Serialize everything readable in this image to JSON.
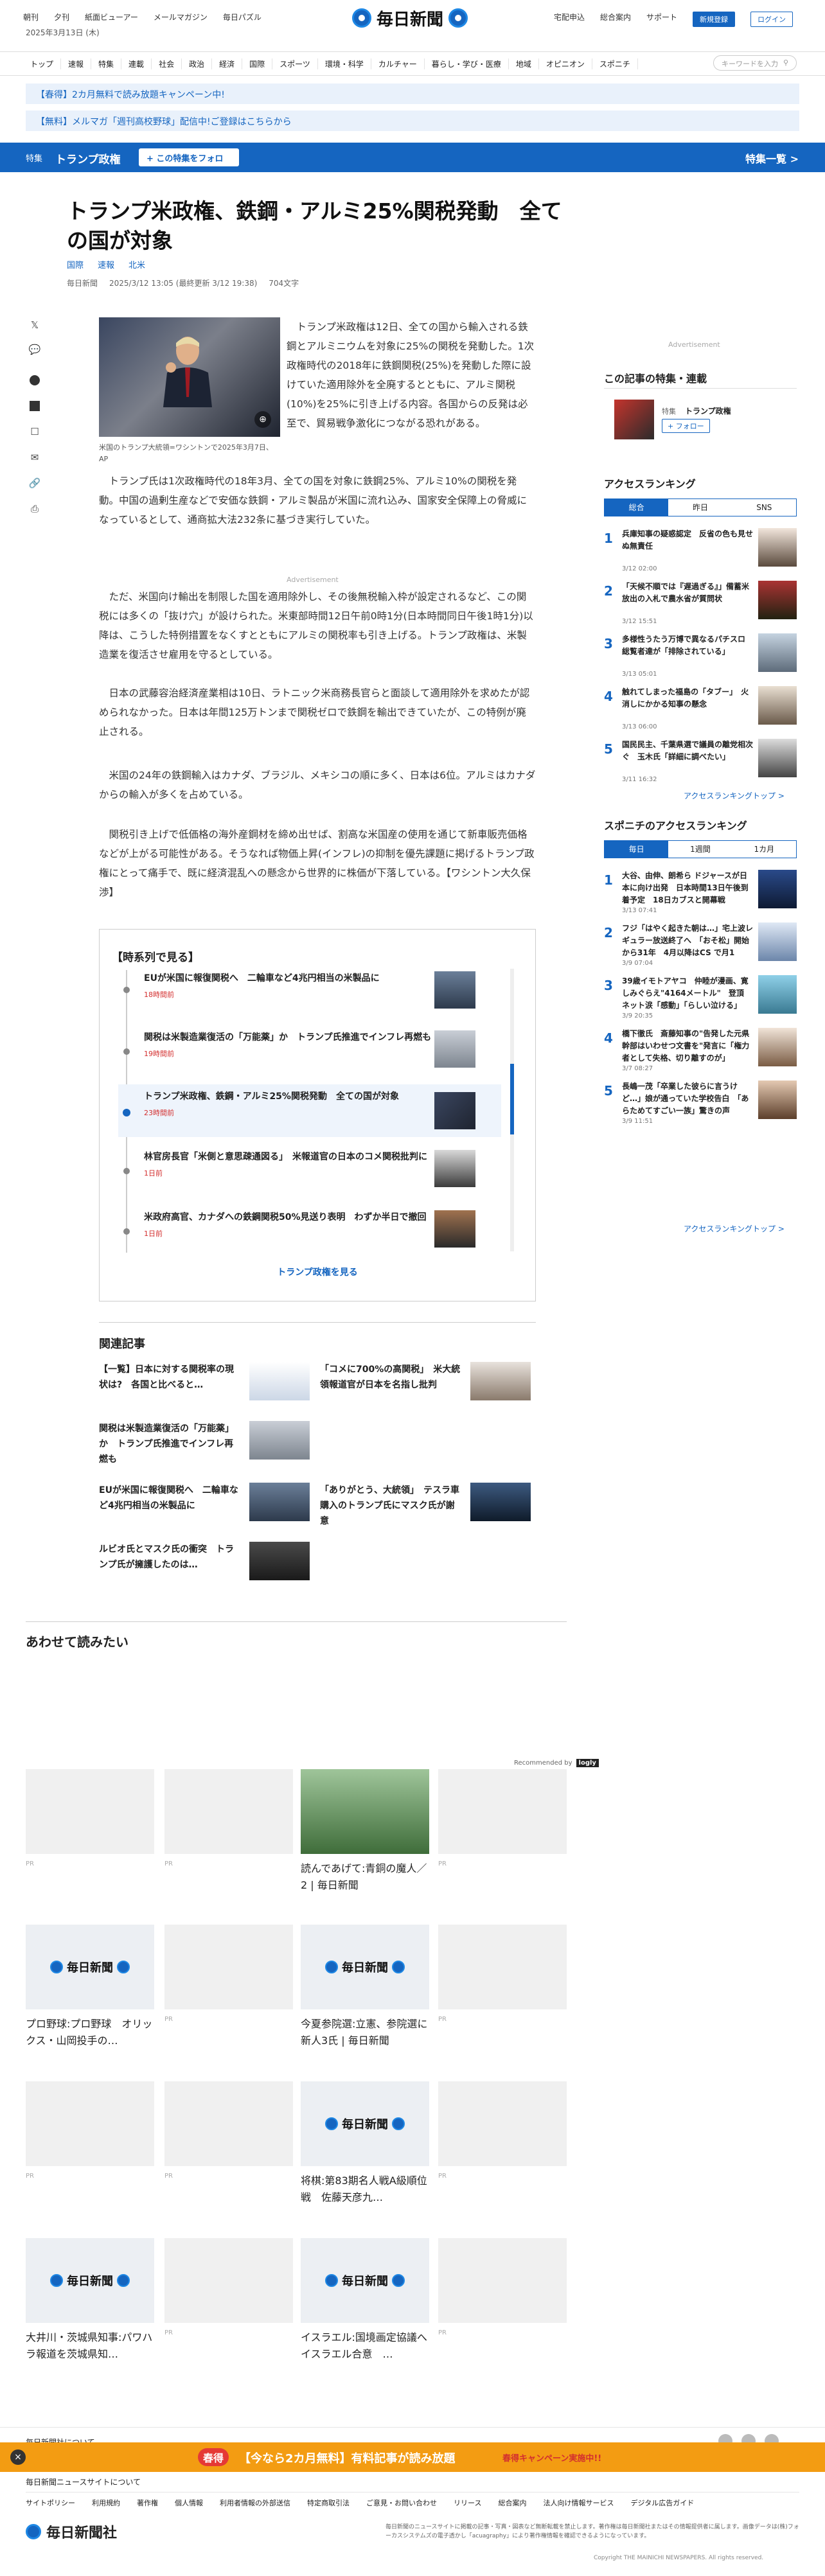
{
  "header": {
    "top_nav": [
      "朝刊",
      "夕刊",
      "紙面ビューアー",
      "メールマガジン",
      "毎日パズル"
    ],
    "date": "2025年3月13日 (木)",
    "logo": "毎日新聞",
    "right_nav": [
      "宅配申込",
      "総合案内",
      "サポート"
    ],
    "register": "新規登録",
    "login": "ログイン"
  },
  "categories": [
    "トップ",
    "速報",
    "特集",
    "連載",
    "社会",
    "政治",
    "経済",
    "国際",
    "スポーツ",
    "環境・科学",
    "カルチャー",
    "暮らし・学び・医療",
    "地域",
    "オピニオン",
    "スポニチ"
  ],
  "search": {
    "placeholder": "キーワードを入力"
  },
  "promos": [
    "【春得】2カ月無料で読み放題キャンペーン中!",
    "【無料】メルマガ「週刊高校野球」配信中!ご登録はこちらから"
  ],
  "tokushu": {
    "label": "特集",
    "name": "トランプ政権",
    "follow": "+ この特集をフォロー",
    "list": "特集一覧 >"
  },
  "article": {
    "title": "トランプ米政権、鉄鋼・アルミ25%関税発動　全ての国が対象",
    "tags": [
      "国際",
      "速報",
      "北米"
    ],
    "source": "毎日新聞",
    "date": "2025/3/12 13:05 (最終更新 3/12 19:38)",
    "chars": "704文字",
    "caption": "米国のトランプ大統領=ワシントンで2025年3月7日、AP",
    "p1": "トランプ米政権は12日、全ての国から輸入される鉄鋼とアルミニウムを対象に25%の関税を発動した。1次政権時代の2018年に鉄鋼関税(25%)を発動した際に設けていた適用除外を全廃するとともに、アルミ関税(10%)を25%に引き上げる内容。各国からの反発は必至で、貿易戦争激化につながる恐れがある。",
    "p2": "トランプ氏は1次政権時代の18年3月、全ての国を対象に鉄鋼25%、アルミ10%の関税を発動。中国の過剰生産などで安価な鉄鋼・アルミ製品が米国に流れ込み、国家安全保障上の脅威になっているとして、通商拡大法232条に基づき実行していた。",
    "ad": "Advertisement",
    "p3": "ただ、米国向け輸出を制限した国を適用除外し、その後無税輸入枠が設定されるなど、この関税には多くの「抜け穴」が設けられた。米東部時間12日午前0時1分(日本時間同日午後1時1分)以降は、こうした特例措置をなくすとともにアルミの関税率も引き上げる。トランプ政権は、米製造業を復活させ雇用を守るとしている。",
    "p4": "日本の武藤容治経済産業相は10日、ラトニック米商務長官らと面談して適用除外を求めたが認められなかった。日本は年間125万トンまで関税ゼロで鉄鋼を輸出できていたが、この特例が廃止される。",
    "p5": "米国の24年の鉄鋼輸入はカナダ、ブラジル、メキシコの順に多く、日本は6位。アルミはカナダからの輸入が多くを占めている。",
    "p6": "関税引き上げで低価格の海外産鋼材を締め出せば、割高な米国産の使用を通じて新車販売価格などが上がる可能性がある。そうなれば物価上昇(インフレ)の抑制を優先課題に掲げるトランプ政権にとって痛手で、既に経済混乱への懸念から世界的に株価が下落している。【ワシントン大久保渉】"
  },
  "timeline": {
    "heading": "【時系列で見る】",
    "items": [
      {
        "title": "EUが米国に報復関税へ　二輪車など4兆円相当の米製品に",
        "date": "18時間前"
      },
      {
        "title": "関税は米製造業復活の「万能薬」か　トランプ氏推進でインフレ再燃も",
        "date": "19時間前"
      },
      {
        "title": "トランプ米政権、鉄鋼・アルミ25%関税発動　全ての国が対象",
        "date": "23時間前"
      },
      {
        "title": "林官房長官「米側と意思疎通図る」　米報道官の日本のコメ関税批判に",
        "date": "1日前"
      },
      {
        "title": "米政府高官、カナダへの鉄鋼関税50%見送り表明　わずか半日で撤回",
        "date": "1日前"
      }
    ],
    "more": "トランプ政権を見る"
  },
  "related": {
    "heading": "関連記事",
    "items": [
      "【一覧】日本に対する関税率の現状は?　各国と比べると…",
      "「コメに700%の高関税」　米大統領報道官が日本を名指し批判",
      "関税は米製造業復活の「万能薬」か　トランプ氏推進でインフレ再燃も",
      "EUが米国に報復関税へ　二輪車など4兆円相当の米製品に",
      "「ありがとう、大統領」　テスラ車購入のトランプ氏にマスク氏が謝意",
      "ルビオ氏とマスク氏の衝突　トランプ氏が擁護したのは…"
    ]
  },
  "awase": {
    "heading": "あわせて読みたい",
    "recommended": "Recommended by",
    "brand": "logly",
    "cards": [
      {
        "text": "",
        "pr": "PR"
      },
      {
        "text": "",
        "pr": "PR"
      },
      {
        "text": "読んであげて:青銅の魔人／2 | 毎日新聞",
        "pr": ""
      },
      {
        "text": "",
        "pr": "PR"
      },
      {
        "text": "プロ野球:プロ野球　オリックス・山岡投手の…",
        "pr": ""
      },
      {
        "text": "",
        "pr": "PR"
      },
      {
        "text": "今夏参院選:立憲、参院選に新人3氏 | 毎日新聞",
        "pr": ""
      },
      {
        "text": "",
        "pr": "PR"
      },
      {
        "text": "",
        "pr": "PR"
      },
      {
        "text": "",
        "pr": "PR"
      },
      {
        "text": "将棋:第83期名人戦A級順位戦　佐藤天彦九…",
        "pr": ""
      },
      {
        "text": "",
        "pr": "PR"
      },
      {
        "text": "大井川・茨城県知事:パワハラ報道を茨城県知…",
        "pr": ""
      },
      {
        "text": "",
        "pr": "PR"
      },
      {
        "text": "イスラエル:国境画定協議へイスラエル合意　…",
        "pr": ""
      },
      {
        "text": "",
        "pr": "PR"
      }
    ]
  },
  "sidebar": {
    "ad": "Advertisement",
    "series_heading": "この記事の特集・連載",
    "series_label": "特集",
    "series_name": "トランプ政権",
    "series_follow": "+ フォロー",
    "ranking_heading": "アクセスランキング",
    "ranking_tabs": [
      "総合",
      "昨日",
      "SNS"
    ],
    "ranking": [
      {
        "title": "兵庫知事の疑惑認定　反省の色も見せぬ無責任",
        "date": "3/12 02:00"
      },
      {
        "title": "「天候不順では『遅過ぎる』」備蓄米放出の入札で農水省が質問状",
        "date": "3/12 15:51"
      },
      {
        "title": "多様性うたう万博で異なるパチスロ　総覧者達が「排除されている」",
        "date": "3/13 05:01"
      },
      {
        "title": "触れてしまった福島の「タブー」　火消しにかかる知事の懸念",
        "date": "3/13 06:00"
      },
      {
        "title": "国民民主、千葉県選で議員の離党相次ぐ　玉木氏「詳細に調べたい」",
        "date": "3/11 16:32"
      }
    ],
    "ranking_more": "アクセスランキングトップ >",
    "sponichi_heading": "スポニチのアクセスランキング",
    "sponichi_tabs": [
      "毎日",
      "1週間",
      "1カ月"
    ],
    "sponichi": [
      {
        "title": "大谷、由伸、朗希ら ドジャースが日本に向け出発　日本時間13日午後到着予定　18日カブスと開幕戦",
        "date": "3/13 07:41"
      },
      {
        "title": "フジ「はやく起きた朝は…」宅上波レギュラー放送終了へ　「おそ松」開始から31年　4月以降はCS で月1",
        "date": "3/9 07:04"
      },
      {
        "title": "39歳イモトアヤコ　仲睦が漫画、寛しみぐらえ\"4164メートル\"　登頂　ネット涙「感動」「らしい泣ける」",
        "date": "3/9 20:35"
      },
      {
        "title": "橋下徹氏　斎藤知事の\"告発した元県幹部はいわせつ文書を\"発言に「権力者として失格、切り離すのが」",
        "date": "3/7 08:27"
      },
      {
        "title": "長嶋一茂「卒業した彼らに言うけど…」娘が通っていた学校告白　「あらためてすごい一族」驚きの声",
        "date": "3/9 11:51"
      }
    ]
  },
  "banner": {
    "badge": "春得",
    "text": "【今なら2カ月無料】有料記事が読み放題",
    "cta": "春得キャンペーン実施中!!"
  },
  "footer": {
    "about": "毎日新聞社について",
    "site_heading": "毎日新聞ニュースサイトについて",
    "links": [
      "サイトポリシー",
      "利用規約",
      "著作権",
      "個人情報",
      "利用者情報の外部送信",
      "特定商取引法",
      "ご意見・お問い合わせ",
      "リリース",
      "総合案内",
      "法人向け情報サービス",
      "デジタル広告ガイド"
    ],
    "company": "毎日新聞社",
    "notice": "毎日新聞のニュースサイトに掲載の記事・写真・図表など無断転載を禁止します。著作権は毎日新聞社またはその情報提供者に属します。画像データは(株)フォーカスシステムズの電子透かし「acuagraphy」により著作権情報を確認できるようになっています。",
    "copyright": "Copyright THE MAINICHI NEWSPAPERS. All rights reserved."
  },
  "colors": {
    "brand": "#1565c0",
    "accent": "#d32f2f",
    "banner": "#f39c12"
  }
}
